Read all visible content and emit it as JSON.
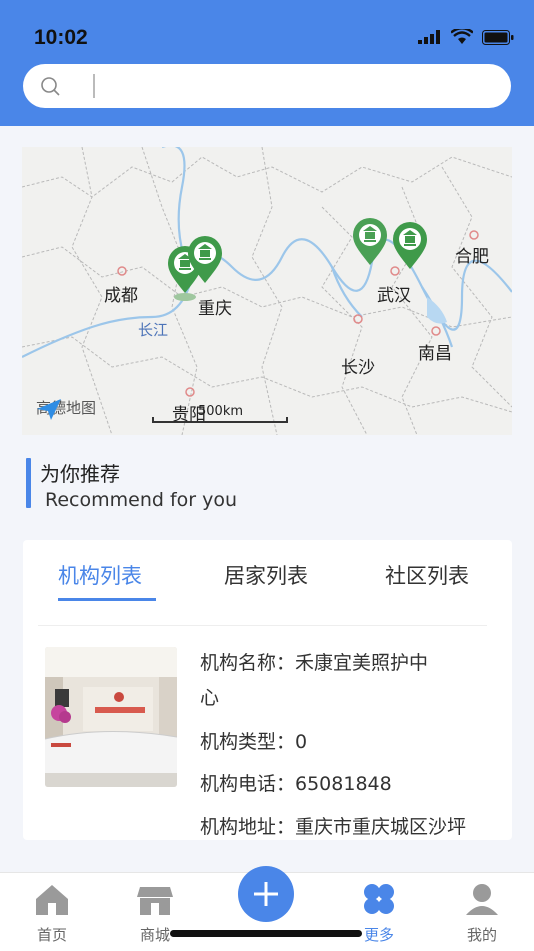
{
  "status": {
    "time": "10:02"
  },
  "search": {
    "placeholder": ""
  },
  "map": {
    "cities": [
      "成都",
      "重庆",
      "武汉",
      "合肥",
      "长沙",
      "南昌",
      "贵阳"
    ],
    "river": "长江",
    "scale": "500km",
    "brand": "高德地图"
  },
  "recommend": {
    "title": "为你推荐",
    "subtitle": "Recommend for you"
  },
  "tabs": [
    "机构列表",
    "居家列表",
    "社区列表"
  ],
  "org": {
    "name_line1": "机构名称：禾康宜美照护中",
    "name_line2": "心",
    "type": "机构类型：0",
    "phone": "机构电话：65081848",
    "address": "机构地址：重庆市重庆城区沙坪"
  },
  "tabbar": [
    "首页",
    "商城",
    "更多",
    "我的"
  ],
  "colors": {
    "primary": "#4a86e8",
    "marker": "#3f9a4a"
  }
}
